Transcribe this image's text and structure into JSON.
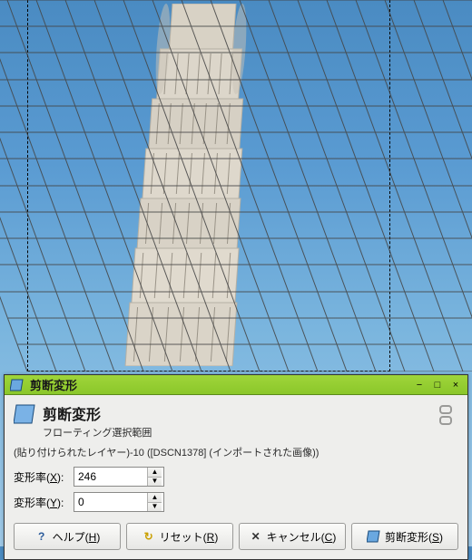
{
  "window": {
    "title": "剪断変形",
    "minimize": "−",
    "maximize": "□",
    "close": "×"
  },
  "dialog": {
    "heading": "剪断変形",
    "subheading": "フローティング選択範囲",
    "context": "(貼り付けられたレイヤー)-10 ([DSCN1378] (インポートされた画像))",
    "x_label": "変形率(",
    "x_mnemonic": "X",
    "x_label_suffix": "):",
    "x_value": "246",
    "y_label": "変形率(",
    "y_mnemonic": "Y",
    "y_label_suffix": "):",
    "y_value": "0"
  },
  "buttons": {
    "help": "ヘルプ(",
    "help_mnemonic": "H",
    "help_suffix": ")",
    "reset": "リセット(",
    "reset_mnemonic": "R",
    "reset_suffix": ")",
    "cancel": "キャンセル(",
    "cancel_mnemonic": "C",
    "cancel_suffix": ")",
    "shear": "剪断変形(",
    "shear_mnemonic": "S",
    "shear_suffix": ")"
  },
  "icons": {
    "help": "?",
    "reset": "↻",
    "cancel": "✕"
  }
}
